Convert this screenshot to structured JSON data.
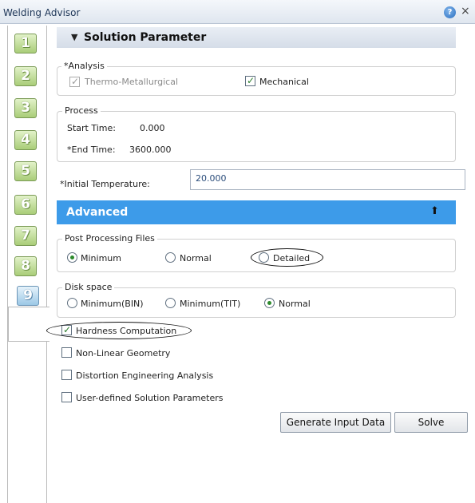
{
  "window": {
    "title": "Welding Advisor",
    "help_glyph": "?",
    "close_glyph": "×"
  },
  "steps": {
    "labels": [
      "1",
      "2",
      "3",
      "4",
      "5",
      "6",
      "7",
      "8",
      "9"
    ],
    "active": "9"
  },
  "section": {
    "caret": "▼",
    "title": "Solution Parameter"
  },
  "analysis": {
    "legend": "*Analysis",
    "thermo_label": "Thermo-Metallurgical",
    "thermo_checked": true,
    "thermo_enabled": false,
    "mechanical_label": "Mechanical",
    "mechanical_checked": true
  },
  "process": {
    "legend": "Process",
    "start_label": "Start Time:",
    "start_value": "0.000",
    "end_label": "*End Time:",
    "end_value": "3600.000"
  },
  "initial_temperature": {
    "label": "*Initial Temperature:",
    "value": "20.000"
  },
  "advanced": {
    "title": "Advanced",
    "collapse_glyph": "⬆"
  },
  "post_processing": {
    "legend": "Post Processing Files",
    "options": [
      "Minimum",
      "Normal",
      "Detailed"
    ],
    "selected": "Minimum"
  },
  "disk_space": {
    "legend": "Disk space",
    "options": [
      "Minimum(BIN)",
      "Minimum(TIT)",
      "Normal"
    ],
    "selected": "Normal"
  },
  "options": {
    "hardness": {
      "label": "Hardness Computation",
      "checked": true
    },
    "nonlinear": {
      "label": "Non-Linear Geometry",
      "checked": false
    },
    "distortion": {
      "label": "Distortion Engineering Analysis",
      "checked": false
    },
    "user_defined": {
      "label": "User-defined Solution Parameters",
      "checked": false
    }
  },
  "actions": {
    "generate_label": "Generate Input Data",
    "solve_label": "Solve"
  }
}
